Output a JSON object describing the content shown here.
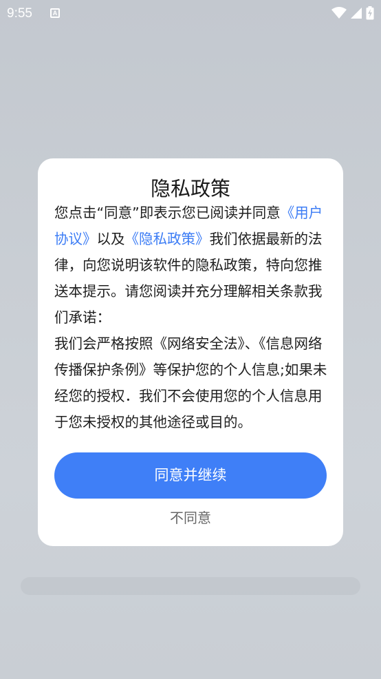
{
  "status_bar": {
    "time": "9:55",
    "notification_icon": "A"
  },
  "dialog": {
    "title": "隐私政策",
    "body_parts": {
      "p1_pre": "您点击“同意”即表示您已阅读并同意",
      "p1_link_user_agreement": "《用户协议》",
      "p1_mid": "以及",
      "p1_link_privacy_policy": "《隐私政策》",
      "p1_post": "我们依据最新的法律，向您说明该软件的隐私政策，特向您推送本提示。请您阅读并充分理解相关条款我们承诺：",
      "p2": "我们会严格按照《网络安全法》、《信息网络传播保护条例》等保护您的个人信息;如果未经您的授权．我们不会使用您的个人信息用于您未授权的其他途径或目的。"
    },
    "agree_label": "同意并继续",
    "disagree_label": "不同意"
  },
  "colors": {
    "accent": "#3f7ff7",
    "link": "#3d7df5",
    "dialog_bg": "#ffffff"
  }
}
